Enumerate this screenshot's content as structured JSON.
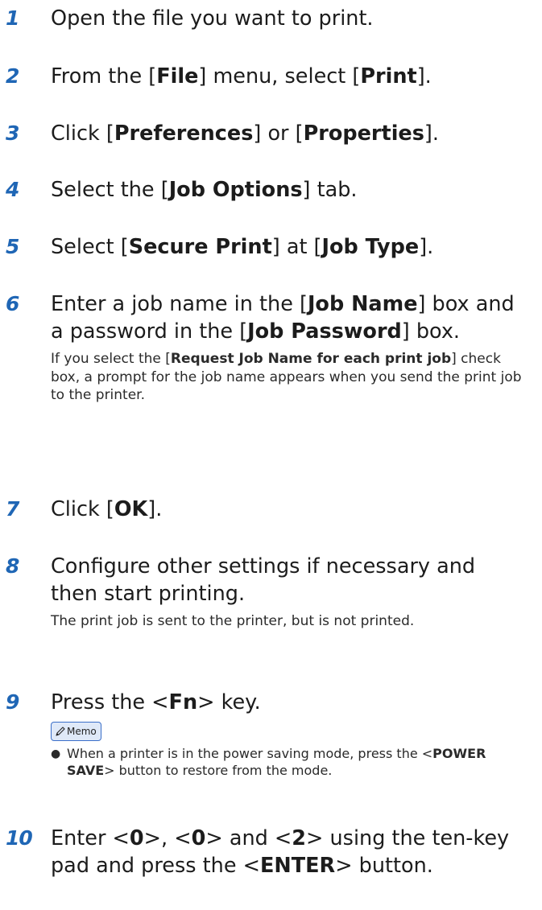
{
  "steps": [
    {
      "num": "1",
      "parts": [
        "Open the file you want to print."
      ]
    },
    {
      "num": "2",
      "parts": [
        "From the [",
        "File",
        "] menu, select [",
        "Print",
        "]."
      ]
    },
    {
      "num": "3",
      "parts": [
        "Click [",
        "Preferences",
        "] or [",
        "Properties",
        "]."
      ]
    },
    {
      "num": "4",
      "parts": [
        "Select the [",
        "Job Options",
        "] tab."
      ]
    },
    {
      "num": "5",
      "parts": [
        "Select [",
        "Secure Print",
        "] at [",
        "Job Type",
        "]."
      ]
    },
    {
      "num": "6",
      "parts": [
        "Enter a job name in the [",
        "Job Name",
        "] box and a password in the [",
        "Job Password",
        "] box."
      ],
      "detail": [
        "If you select the [",
        "Request Job Name for each print job",
        "] check box, a prompt for the job name appears when you send the print job to the printer."
      ]
    },
    {
      "num": "7",
      "parts": [
        "Click [",
        "OK",
        "]."
      ]
    },
    {
      "num": "8",
      "parts": [
        "Configure other settings if necessary and then start printing."
      ],
      "detail": [
        "The print job is sent to the printer, but is not printed."
      ]
    },
    {
      "num": "9",
      "parts": [
        "Press the <",
        "Fn",
        "> key."
      ],
      "memo_label": "Memo",
      "memo_icon": "pencil-icon",
      "memo_items": [
        [
          "When a printer is in the power saving mode, press the <",
          "POWER SAVE",
          "> button to restore from the mode."
        ]
      ]
    },
    {
      "num": "10",
      "parts": [
        "Enter <",
        "0",
        ">, <",
        "0",
        "> and <",
        "2",
        "> using the ten-key pad and press the <",
        "ENTER",
        "> button."
      ]
    }
  ],
  "colors": {
    "step_number": "#1f66b5",
    "memo_border": "#3b6fc9",
    "memo_fill": "#dfe9f8"
  }
}
